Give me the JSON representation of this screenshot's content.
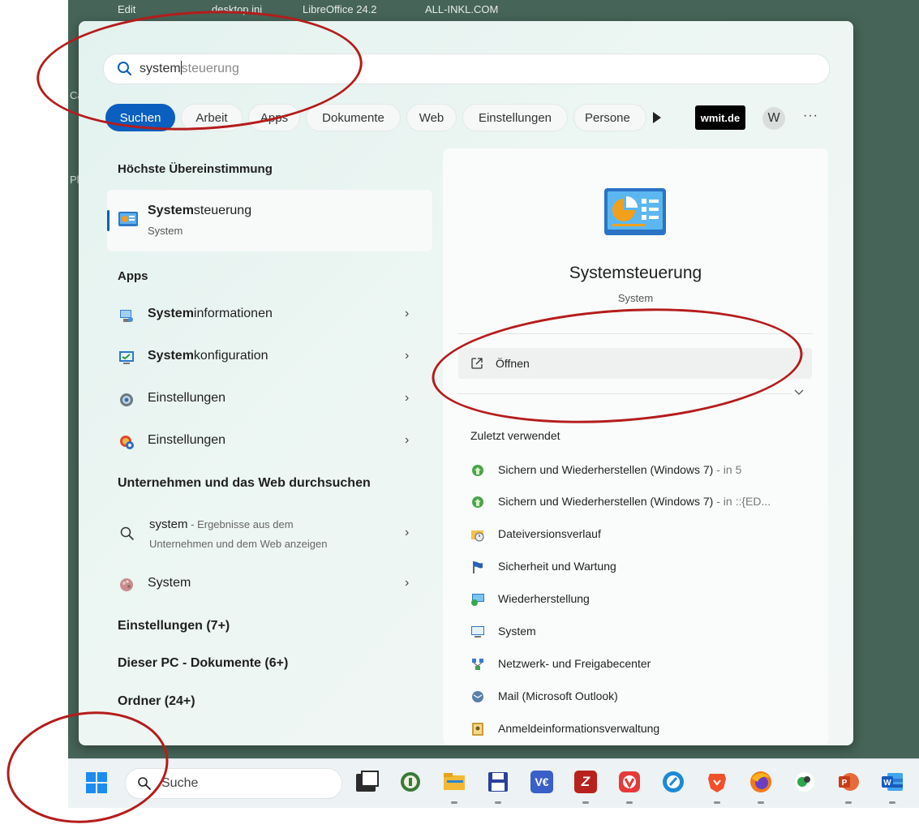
{
  "desktop": {
    "top_labels": [
      "Edit",
      "desktop.ini",
      "LibreOffice 24.2",
      "ALL-INKL.COM"
    ],
    "edge_chars": [
      "Ca",
      "Pl"
    ]
  },
  "search": {
    "query_typed": "system",
    "query_completion": "steuerung"
  },
  "filters": {
    "tabs": [
      {
        "label": "Suchen",
        "active": true
      },
      {
        "label": "Arbeit"
      },
      {
        "label": "Apps"
      },
      {
        "label": "Dokumente"
      },
      {
        "label": "Web"
      },
      {
        "label": "Einstellungen"
      },
      {
        "label": "Persone"
      }
    ],
    "wmit_label": "wmit.de",
    "avatar_letter": "W",
    "more_label": "···"
  },
  "results": {
    "best_match_heading": "Höchste Übereinstimmung",
    "best_match": {
      "title_bold": "System",
      "title_rest": "steuerung",
      "subtitle": "System"
    },
    "apps_heading": "Apps",
    "apps": [
      {
        "bold": "System",
        "rest": "informationen",
        "icon": "system-information-icon"
      },
      {
        "bold": "System",
        "rest": "konfiguration",
        "icon": "system-configuration-icon"
      },
      {
        "bold": "",
        "rest": "Einstellungen",
        "icon": "settings-gear-icon"
      },
      {
        "bold": "",
        "rest": "Einstellungen",
        "icon": "settings-colorful-icon"
      }
    ],
    "web_heading": "Unternehmen und das Web durchsuchen",
    "web_item": {
      "query": "system",
      "line1_rest": " - Ergebnisse aus dem",
      "line2": "Unternehmen und dem Web anzeigen"
    },
    "system_item": "System",
    "settings_group": "Einstellungen (7+)",
    "documents_group": "Dieser PC - Dokumente (6+)",
    "folders_group": "Ordner (24+)"
  },
  "detail": {
    "title": "Systemsteuerung",
    "subtitle": "System",
    "open_label": "Öffnen",
    "recent_heading": "Zuletzt verwendet",
    "recent_items": [
      {
        "label": "Sichern und Wiederherstellen (Windows 7)",
        "suffix": " - in 5",
        "icon": "backup-restore-icon"
      },
      {
        "label": "Sichern und Wiederherstellen (Windows 7)",
        "suffix": " - in ::{ED...",
        "icon": "backup-restore-icon"
      },
      {
        "label": "Dateiversionsverlauf",
        "suffix": "",
        "icon": "file-history-icon"
      },
      {
        "label": "Sicherheit und Wartung",
        "suffix": "",
        "icon": "security-flag-icon"
      },
      {
        "label": "Wiederherstellung",
        "suffix": "",
        "icon": "recovery-icon"
      },
      {
        "label": "System",
        "suffix": "",
        "icon": "system-monitor-icon"
      },
      {
        "label": "Netzwerk- und Freigabecenter",
        "suffix": "",
        "icon": "network-center-icon"
      },
      {
        "label": "Mail (Microsoft Outlook)",
        "suffix": "",
        "icon": "mail-icon"
      },
      {
        "label": "Anmeldeinformationsverwaltung",
        "suffix": "",
        "icon": "credential-manager-icon"
      }
    ]
  },
  "taskbar": {
    "search_label": "Suche",
    "apps": [
      "task-view",
      "keepass",
      "file-explorer",
      "save-app",
      "veracrypt",
      "filezilla",
      "vivaldi",
      "ccleaner",
      "brave",
      "firefox",
      "ai-app",
      "evernote",
      "powerpoint",
      "word"
    ]
  },
  "colors": {
    "accent": "#0a5fbf",
    "annotation": "#b51c1c",
    "desktop": "#466458"
  }
}
